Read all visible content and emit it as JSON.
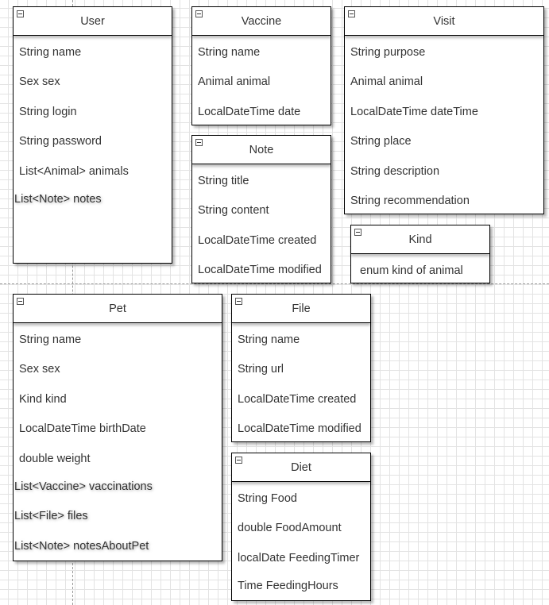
{
  "entities": {
    "user": {
      "title": "User",
      "fields": [
        "String name",
        "Sex sex",
        "String login",
        "String password",
        "List<Animal> animals",
        "List<Note>  notes"
      ]
    },
    "vaccine": {
      "title": "Vaccine",
      "fields": [
        "String name",
        "Animal animal",
        "LocalDateTime date"
      ]
    },
    "visit": {
      "title": "Visit",
      "fields": [
        "String purpose",
        "Animal animal",
        "LocalDateTime dateTime",
        "String place",
        "String description",
        "String recommendation"
      ]
    },
    "note": {
      "title": "Note",
      "fields": [
        "String title",
        "String content",
        "LocalDateTime created",
        "LocalDateTime modified"
      ]
    },
    "kind": {
      "title": "Kind",
      "fields": [
        "enum kind of animal"
      ]
    },
    "pet": {
      "title": "Pet",
      "fields": [
        "String name",
        "Sex sex",
        "Kind kind",
        "LocalDateTime birthDate",
        "double weight",
        "List<Vaccine>  vaccinations",
        "List<File>  files",
        "List<Note>  notesAboutPet"
      ]
    },
    "file": {
      "title": "File",
      "fields": [
        "String name",
        "String url",
        "LocalDateTime created",
        "LocalDateTime modified"
      ]
    },
    "diet": {
      "title": "Diet",
      "fields": [
        "String Food",
        "double FoodAmount",
        "localDate FeedingTimer",
        "Time FeedingHours"
      ]
    }
  }
}
